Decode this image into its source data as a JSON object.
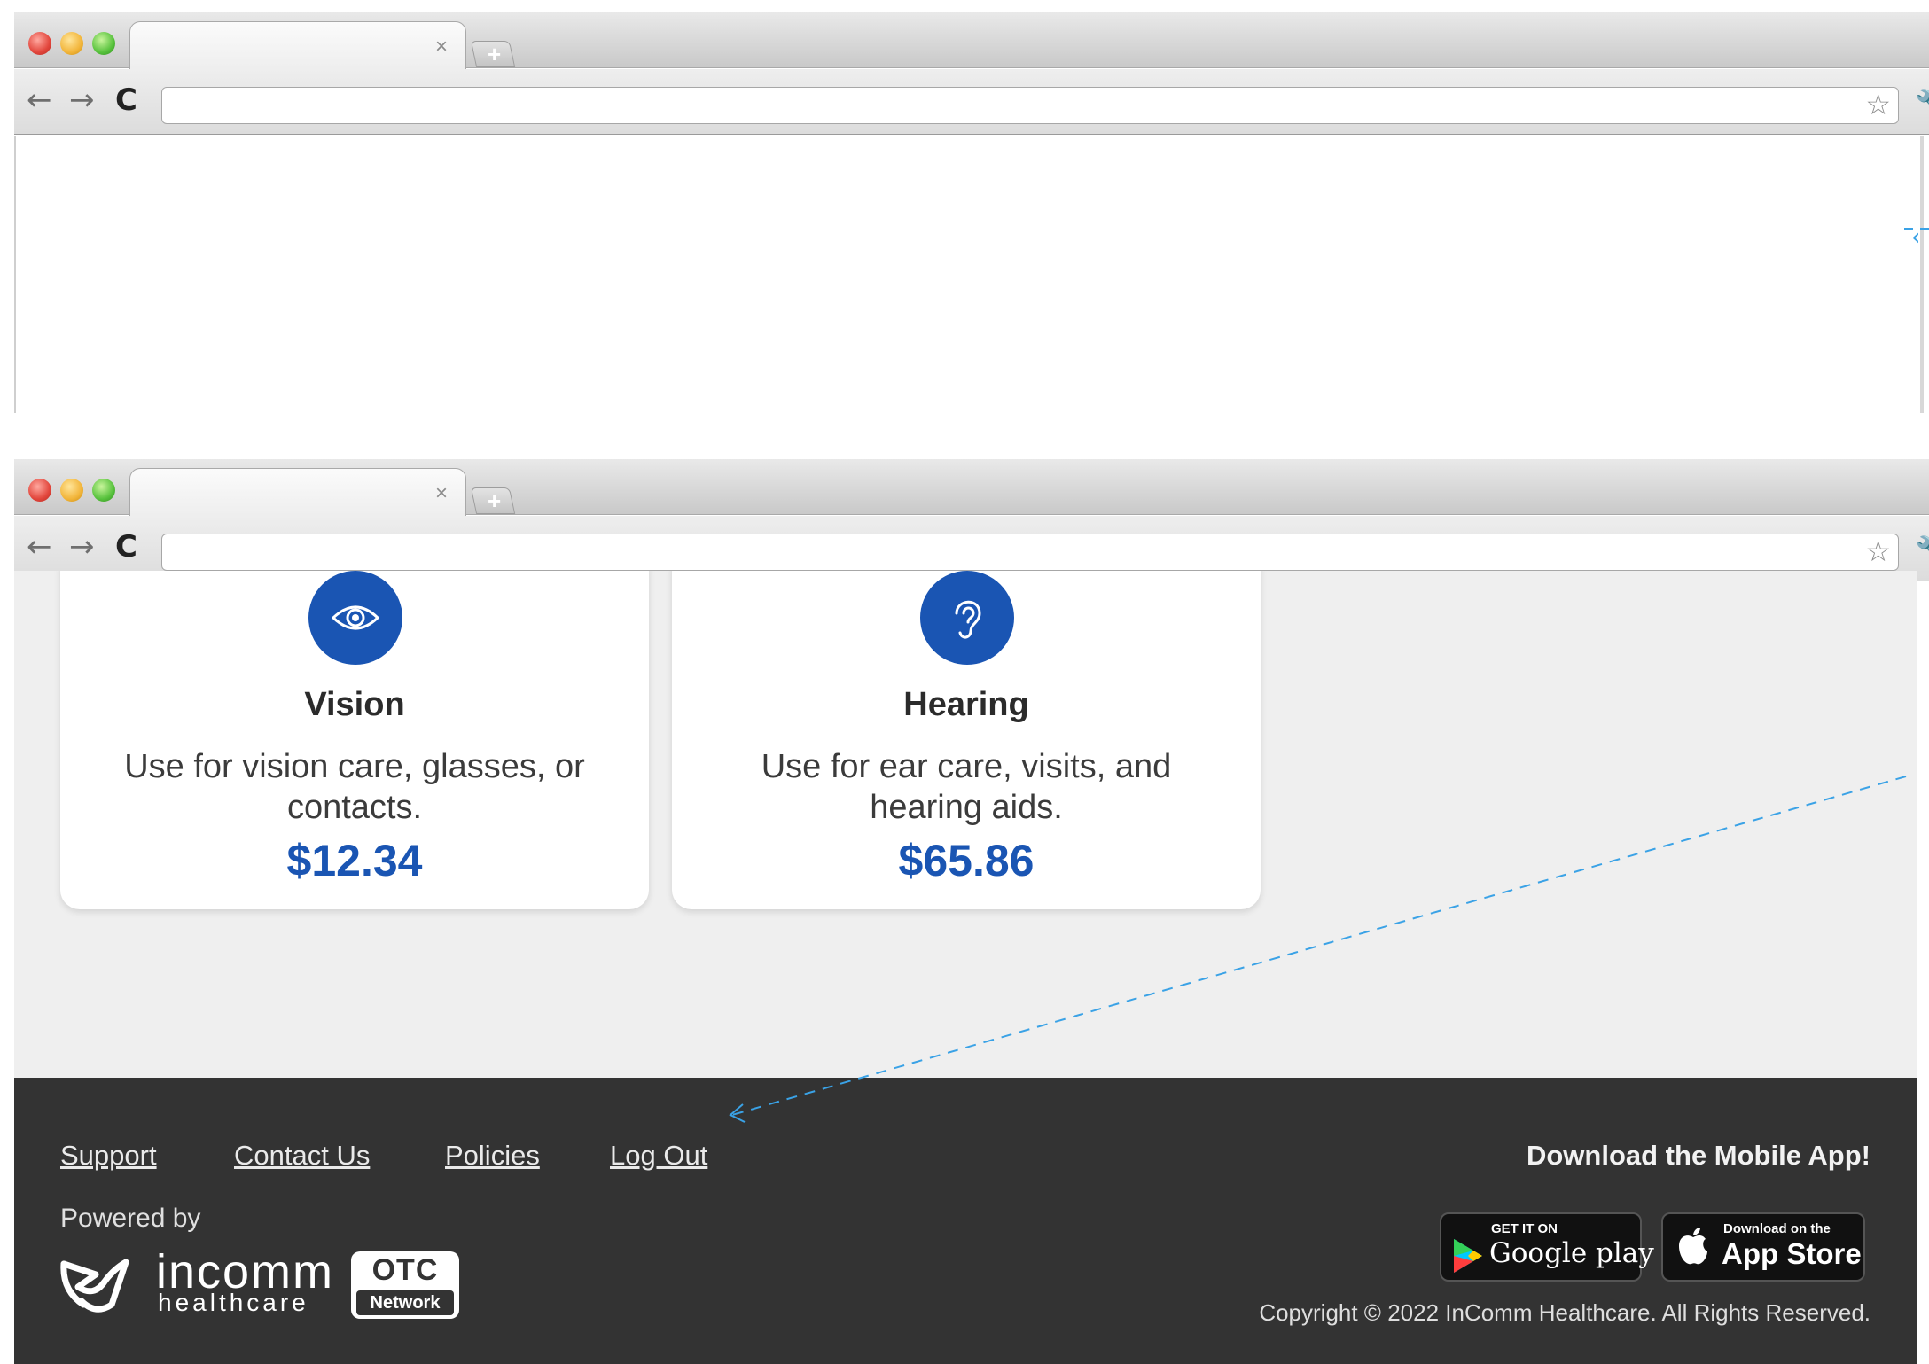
{
  "browser": {
    "tab_close_glyph": "×",
    "new_tab_glyph": "+",
    "back_glyph": "←",
    "forward_glyph": "→",
    "reload_glyph": "C",
    "bookmark_glyph": "☆",
    "wrench_glyph": "🔧",
    "url": ""
  },
  "annotation": {
    "arrow_glyph": "‹",
    "color": "#3aa2e6"
  },
  "cards": [
    {
      "title": "Vision",
      "description": "Use for vision care, glasses, or contacts.",
      "amount": "$12.34",
      "icon": "eye-icon"
    },
    {
      "title": "Hearing",
      "description": "Use for ear care, visits, and hearing aids.",
      "amount": "$65.86",
      "icon": "ear-icon"
    }
  ],
  "footer": {
    "links": [
      "Support",
      "Contact Us",
      "Policies",
      "Log Out"
    ],
    "powered_by": "Powered by",
    "incomm_logo": {
      "line1": "incomm",
      "line2": "healthcare"
    },
    "otc_logo": {
      "line1": "OTC",
      "line2": "Network"
    },
    "app_heading": "Download the Mobile App!",
    "google_badge": {
      "small": "GET IT ON",
      "big": "Google play"
    },
    "apple_badge": {
      "small": "Download on the",
      "big": "App Store"
    },
    "copyright": "Copyright © 2022 InComm Healthcare. All Rights Reserved."
  },
  "colors": {
    "accent_blue": "#1a55b3",
    "footer_bg": "#333333",
    "page_bg": "#efefef"
  }
}
